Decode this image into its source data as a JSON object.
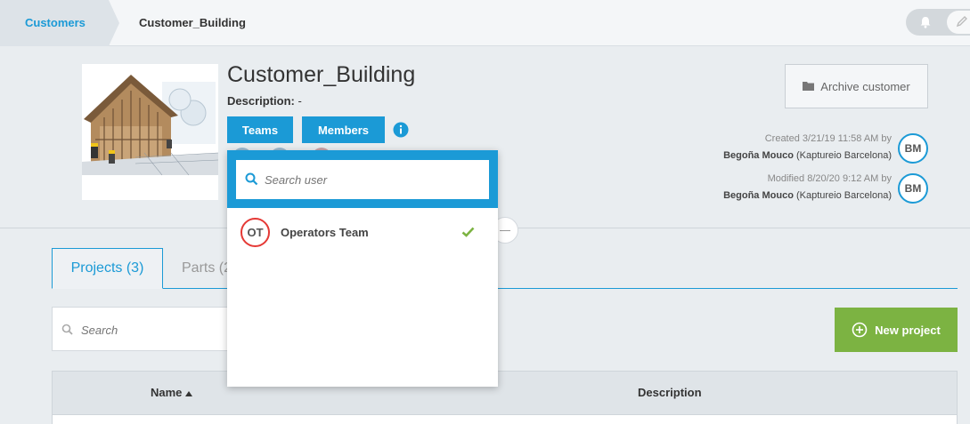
{
  "breadcrumb": {
    "root": "Customers",
    "current": "Customer_Building"
  },
  "customer": {
    "title": "Customer_Building",
    "description_label": "Description:",
    "description_value": "-",
    "teams_label": "Teams",
    "members_label": "Members",
    "archive_label": "Archive customer",
    "created_text": "Created 3/21/19 11:58 AM by",
    "created_by": "Begoña Mouco",
    "created_org": "(Kaptureio Barcelona)",
    "created_initials": "BM",
    "modified_text": "Modified 8/20/20 9:12 AM by",
    "modified_by": "Begoña Mouco",
    "modified_org": "(Kaptureio Barcelona)",
    "modified_initials": "BM"
  },
  "tabs": {
    "projects": "Projects (3)",
    "parts": "Parts (2"
  },
  "projects": {
    "search_placeholder": "Search",
    "new_label": "New project",
    "columns": {
      "name": "Name",
      "description": "Description"
    }
  },
  "teams_dropdown": {
    "search_placeholder": "Search user",
    "items": [
      {
        "initials": "OT",
        "label": "Operators Team",
        "selected": true
      }
    ]
  },
  "colors": {
    "accent": "#1b9ad6",
    "green": "#7cb342",
    "team_red": "#e53935"
  },
  "icons": [
    "bell-icon",
    "pen-icon",
    "folder-icon",
    "info-icon",
    "search-icon",
    "check-icon",
    "plus-circle-icon",
    "sort-asc-icon"
  ]
}
